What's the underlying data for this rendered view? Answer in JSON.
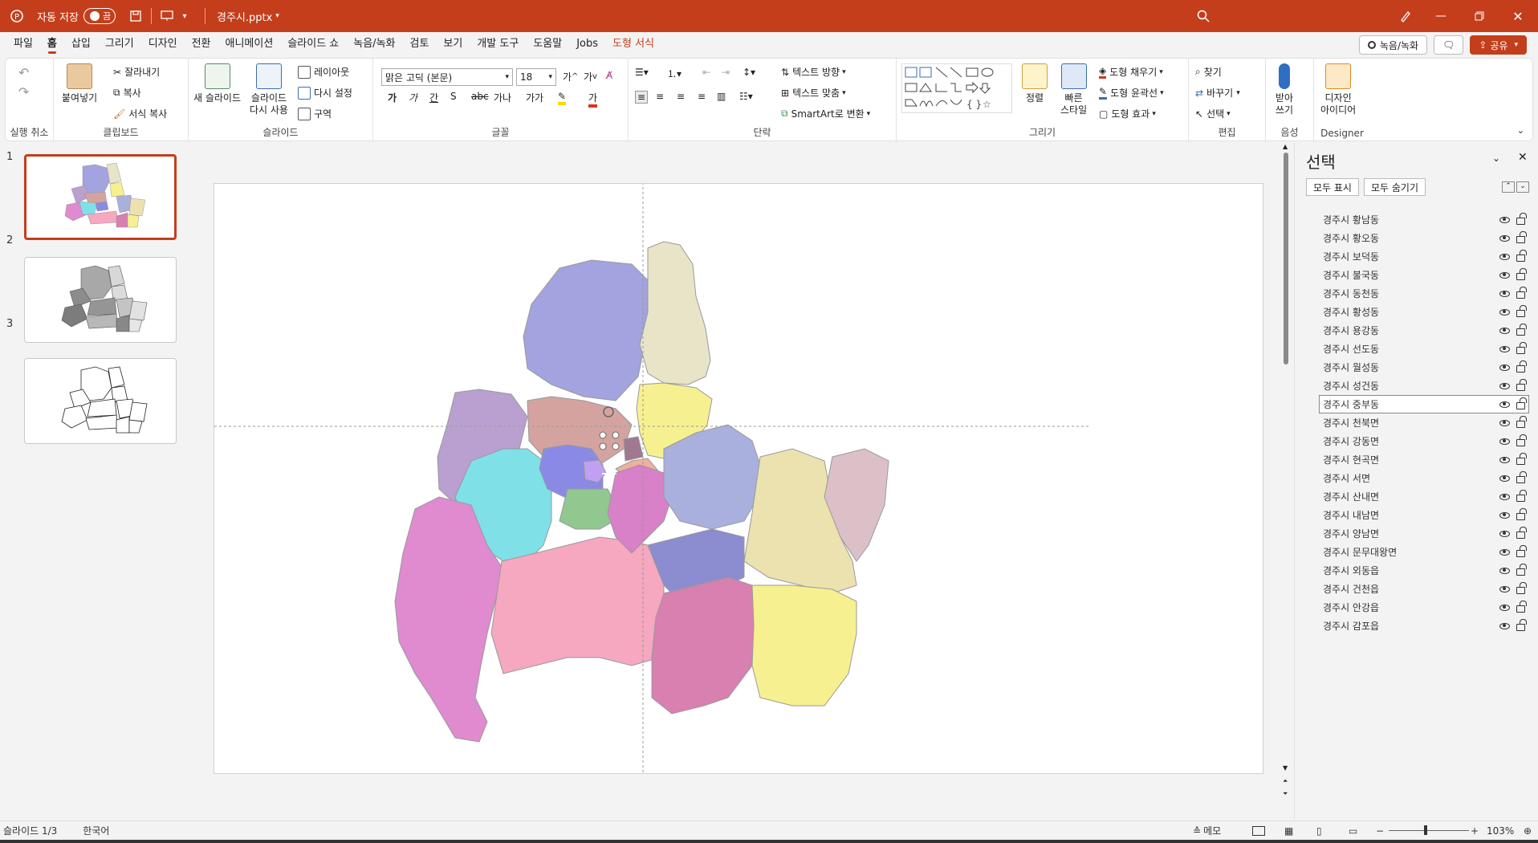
{
  "titlebar": {
    "autosave_label": "자동 저장",
    "autosave_state": "끔",
    "filename": "경주시.pptx"
  },
  "menu": {
    "tabs": [
      "파일",
      "홈",
      "삽입",
      "그리기",
      "디자인",
      "전환",
      "애니메이션",
      "슬라이드 쇼",
      "녹음/녹화",
      "검토",
      "보기",
      "개발 도구",
      "도움말",
      "Jobs",
      "도형 서식"
    ],
    "active_tab": "홈",
    "record_label": "녹음/녹화",
    "share_label": "공유"
  },
  "ribbon": {
    "undo_group": "실행 취소",
    "clipboard": {
      "label": "클립보드",
      "paste": "붙여넣기",
      "cut": "잘라내기",
      "copy": "복사",
      "format_painter": "서식 복사"
    },
    "slides": {
      "label": "슬라이드",
      "new_slide": "새 슬라이드",
      "reuse_slide_1": "슬라이드",
      "reuse_slide_2": "다시 사용",
      "layout": "레이아웃",
      "reset": "다시 설정",
      "section": "구역"
    },
    "font": {
      "label": "글꼴",
      "font_name": "맑은 고딕 (본문)",
      "font_size": "18",
      "bold": "가",
      "italic": "가",
      "underline": "간",
      "strike": "S",
      "spacing": "가나",
      "case": "가가"
    },
    "paragraph": {
      "label": "단락",
      "text_direction": "텍스트 방향",
      "align_text": "텍스트 맞춤",
      "smartart": "SmartArt로 변환"
    },
    "drawing": {
      "label": "그리기",
      "arrange": "정렬",
      "quick_styles_1": "빠른",
      "quick_styles_2": "스타일",
      "fill": "도형 채우기",
      "outline": "도형 윤곽선",
      "effects": "도형 효과"
    },
    "editing": {
      "label": "편집",
      "find": "찾기",
      "replace": "바꾸기",
      "select": "선택"
    },
    "voice": {
      "label": "음성",
      "dictate_1": "받아",
      "dictate_2": "쓰기"
    },
    "designer": {
      "label": "Designer",
      "ideas_1": "디자인",
      "ideas_2": "아이디어"
    }
  },
  "thumbnails": [
    "1",
    "2",
    "3"
  ],
  "selection_pane": {
    "title": "선택",
    "show_all": "모두 표시",
    "hide_all": "모두 숨기기",
    "items": [
      "경주시 황남동",
      "경주시 황오동",
      "경주시 보덕동",
      "경주시 불국동",
      "경주시 동천동",
      "경주시 황성동",
      "경주시 용강동",
      "경주시 선도동",
      "경주시 월성동",
      "경주시 성건동",
      "경주시 중부동",
      "경주시 천북면",
      "경주시 강동면",
      "경주시 현곡면",
      "경주시 서면",
      "경주시 산내면",
      "경주시 내남면",
      "경주시 양남면",
      "경주시 문무대왕면",
      "경주시 외동읍",
      "경주시 건천읍",
      "경주시 안강읍",
      "경주시 감포읍"
    ],
    "selected_index": 10
  },
  "statusbar": {
    "slide_info": "슬라이드 1/3",
    "language": "한국어",
    "notes": "메모",
    "zoom": "103%"
  },
  "colors": {
    "accent": "#c43e1c"
  }
}
